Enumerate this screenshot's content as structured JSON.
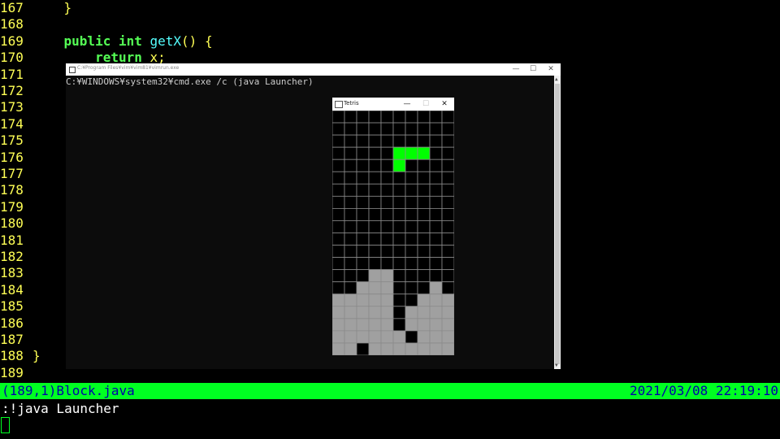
{
  "editor": {
    "lines": [
      {
        "num": "167",
        "code": "    }"
      },
      {
        "num": "168",
        "code": ""
      },
      {
        "num": "169",
        "code": "    public int getX() {"
      },
      {
        "num": "170",
        "code": "        return x;"
      },
      {
        "num": "171",
        "code": ""
      },
      {
        "num": "172",
        "code": ""
      },
      {
        "num": "173",
        "code": ""
      },
      {
        "num": "174",
        "code": ""
      },
      {
        "num": "175",
        "code": ""
      },
      {
        "num": "176",
        "code": ""
      },
      {
        "num": "177",
        "code": ""
      },
      {
        "num": "178",
        "code": ""
      },
      {
        "num": "179",
        "code": ""
      },
      {
        "num": "180",
        "code": ""
      },
      {
        "num": "181",
        "code": ""
      },
      {
        "num": "182",
        "code": ""
      },
      {
        "num": "183",
        "code": ""
      },
      {
        "num": "184",
        "code": ""
      },
      {
        "num": "185",
        "code": ""
      },
      {
        "num": "186",
        "code": ""
      },
      {
        "num": "187",
        "code": ""
      },
      {
        "num": "188",
        "code": "}"
      },
      {
        "num": "189",
        "code": ""
      }
    ]
  },
  "statusline": {
    "left": "(189,1)Block.java",
    "right": "2021/03/08 22:19:10"
  },
  "cmdline": ":!java Launcher",
  "cmd_window": {
    "title": "C:¥Program Files¥vim¥vim81¥vimrun.exe",
    "prompt_text": "C:¥WINDOWS¥system32¥cmd.exe /c (java Launcher)",
    "minimize": "—",
    "maximize": "☐",
    "close": "✕"
  },
  "tetris_window": {
    "title": "Tetris",
    "minimize": "—",
    "maximize": "☐",
    "close": "✕",
    "cols": 10,
    "rows": 20,
    "colors": {
      "empty": "#000000",
      "grid": "#8a8a8a",
      "active": "#00ff00",
      "locked": "#a0a0a0"
    },
    "active_cells": [
      [
        3,
        5
      ],
      [
        3,
        6
      ],
      [
        3,
        7
      ],
      [
        4,
        5
      ]
    ],
    "locked_rows": [
      "..........",
      "..........",
      "..........",
      "..........",
      "..........",
      "..........",
      "..........",
      "..........",
      "..........",
      "..........",
      "..........",
      "..........",
      "..........",
      "...##.....",
      "..###...#.",
      "#####..###",
      "#####.####",
      "#####.####",
      "######.###",
      "##.#######"
    ]
  },
  "colors": {
    "vim_linenr": "#ffff55",
    "vim_keyword": "#55ff55",
    "vim_function": "#55ffff",
    "statusline_bg": "#00ff22",
    "statusline_fg": "#0000aa"
  }
}
